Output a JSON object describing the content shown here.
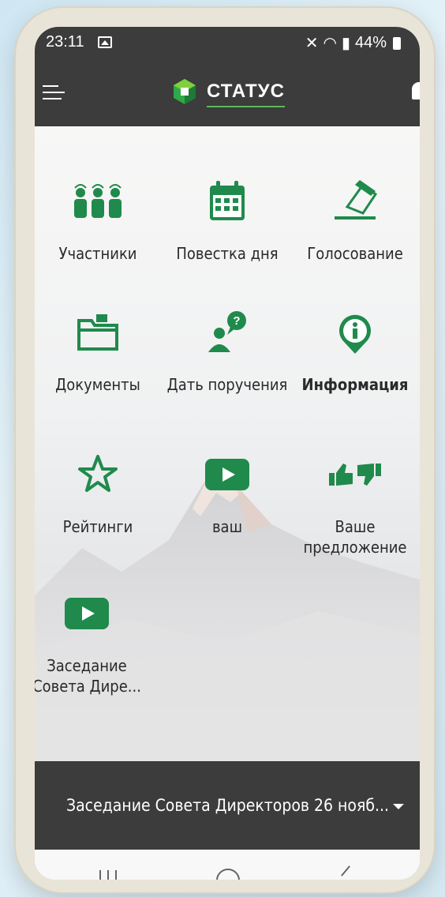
{
  "status_bar": {
    "time": "23:11",
    "battery": "44%",
    "signal_glyphs": "≣ ὏6"
  },
  "app": {
    "title": "СТАТУС",
    "brand_color": "#1f8a4c"
  },
  "grid": [
    {
      "label": "Участники",
      "icon": "participants-icon"
    },
    {
      "label": "Повестка дня",
      "icon": "calendar-icon"
    },
    {
      "label": "Голосование",
      "icon": "vote-icon"
    },
    {
      "label": "Документы",
      "icon": "folder-icon"
    },
    {
      "label": "Дать поручения",
      "icon": "question-person-icon"
    },
    {
      "label": "Информация",
      "icon": "info-icon",
      "bold": true
    },
    {
      "label": "Рейтинги",
      "icon": "star-icon"
    },
    {
      "label": "ваш",
      "icon": "play-icon"
    },
    {
      "label": "Ваше предложение",
      "icon": "thumbs-icon"
    },
    {
      "label": "Заседание Совета Дире...",
      "icon": "play-icon"
    }
  ],
  "bottom": {
    "selected_meeting": "Заседание Совета Директоров 26 нояб..."
  }
}
